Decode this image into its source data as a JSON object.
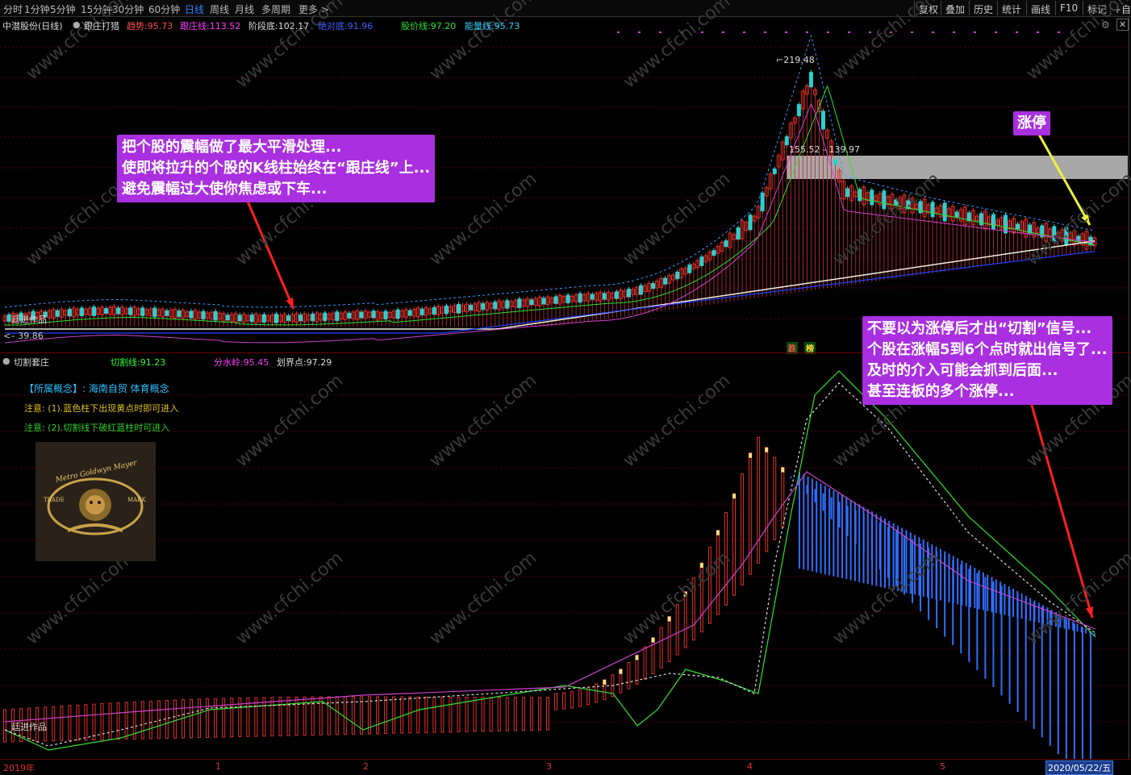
{
  "toolbar": {
    "periods": [
      "分时",
      "1分钟",
      "5分钟",
      "15分钟",
      "30分钟",
      "60分钟",
      "日线",
      "周线",
      "月线",
      "多周期",
      "更多 >"
    ],
    "active_period": "日线",
    "right_buttons": [
      "复权",
      "叠加",
      "历史",
      "统计",
      "画线",
      "F10",
      "标记",
      "+自选"
    ]
  },
  "top_panel": {
    "stock": "中潜股份(日线)",
    "indicator": "跟庄打猎",
    "fields": [
      {
        "label": "趋势:",
        "value": "95.73",
        "color": "#ff5050"
      },
      {
        "label": "跟庄线:",
        "value": "113.52",
        "color": "#ff3cff"
      },
      {
        "label": "阶段底:",
        "value": "102.17",
        "color": "#dddddd"
      },
      {
        "label": "绝对底:",
        "value": "91.96",
        "color": "#4060ff"
      },
      {
        "label": "股价线:",
        "value": "97.20",
        "color": "#30e030"
      },
      {
        "label": "能量线:",
        "value": "95.73",
        "color": "#30d0ff"
      }
    ],
    "high_label": "219.48",
    "low_label": "39.86",
    "zone_label": "155.52 - 139.97",
    "watermark_tag": "廷进作品",
    "badges": [
      "跌",
      "榜"
    ]
  },
  "bottom_panel": {
    "indicator": "切割套庄",
    "fields": [
      {
        "label": "切割线:",
        "value": "91.23",
        "color": "#30ff30"
      },
      {
        "label": "分水岭:",
        "value": "95.45",
        "color": "#ff3cff"
      },
      {
        "label": "划界点:",
        "value": "97.29",
        "color": "#dddddd"
      }
    ],
    "concept": "【所属概念】: 海南自贸 体育概念",
    "note1": "注意: (1).蓝色柱下出现黄点时即可进入",
    "note2": "注意: (2).切割线下破红蓝柱时可进入",
    "watermark_tag": "廷进作品",
    "logo_text": [
      "Metro Goldwyn Mayer",
      "TRADE",
      "MARK"
    ]
  },
  "callouts": {
    "left": [
      "把个股的震幅做了最大平滑处理...",
      "使即将拉升的个股的K线柱始终在“跟庄线”上...",
      "避免震幅过大使你焦虑或下车..."
    ],
    "limit_up": "涨停",
    "right": [
      "不要以为涨停后才出“切割”信号...",
      "个股在涨幅5到6个点时就出信号了...",
      "及时的介入可能会抓到后面...",
      "甚至连板的多个涨停..."
    ]
  },
  "xaxis": {
    "labels": [
      "2019年",
      "1",
      "2",
      "3",
      "4",
      "5"
    ],
    "selected_date": "2020/05/22/五"
  },
  "watermark": "www.cfchi.com",
  "colors": {
    "red_bar": "#e0302a",
    "blue_bar": "#2f6fff",
    "cyan_candle": "#2bd0d0",
    "grid": "#5a0000"
  }
}
